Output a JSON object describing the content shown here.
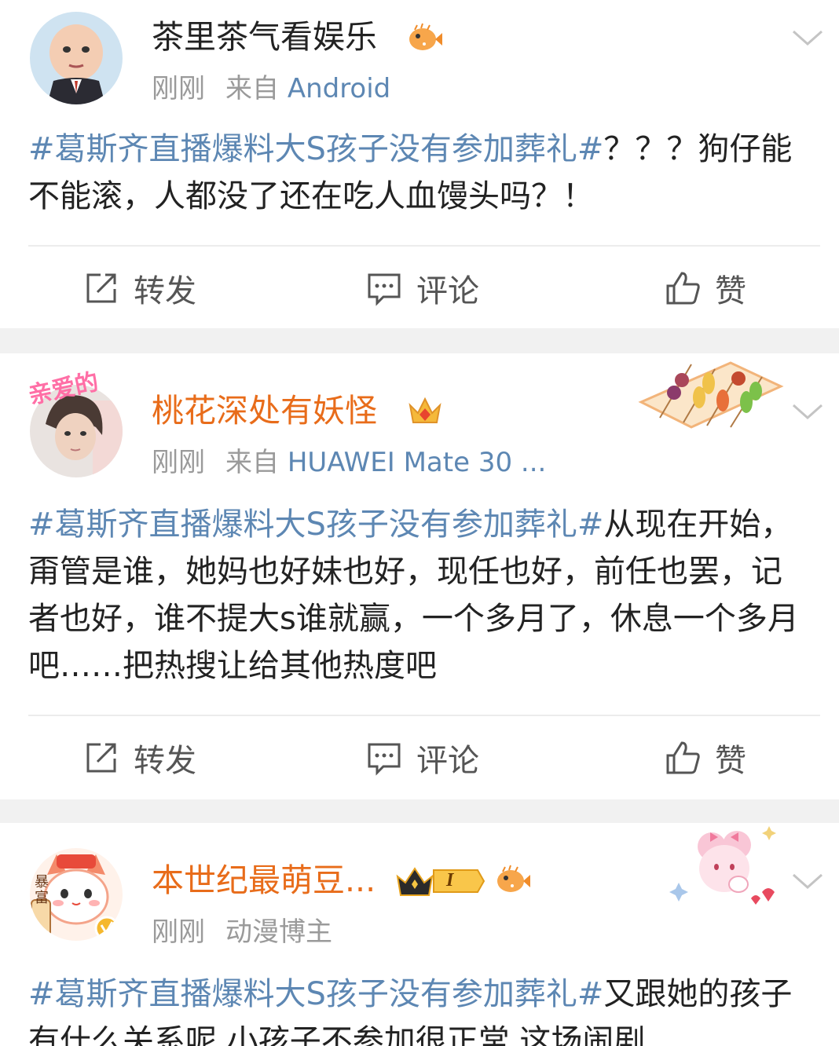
{
  "posts": [
    {
      "user": {
        "name": "茶里茶气看娱乐",
        "badge_icon": "pufferfish-badge-icon"
      },
      "meta": {
        "time": "刚刚",
        "source_prefix": "来自",
        "source": "Android"
      },
      "content": {
        "hashtag": "#葛斯齐直播爆料大S孩子没有参加葬礼#",
        "text": "？？？狗仔能不能滚，人都没了还在吃人血馒头吗？！"
      },
      "actions": {
        "repost": "转发",
        "comment": "评论",
        "like": "赞"
      }
    },
    {
      "user": {
        "name": "桃花深处有妖怪",
        "badge_icon": "crown-badge-icon",
        "avatar_sticker": "亲爱的"
      },
      "meta": {
        "time": "刚刚",
        "source_prefix": "来自",
        "source": "HUAWEI Mate 30 ..."
      },
      "content": {
        "hashtag": "#葛斯齐直播爆料大S孩子没有参加葬礼#",
        "text": "从现在开始，甭管是谁，她妈也好妹也好，现任也好，前任也罢，记者也好，谁不提大s谁就赢，一个多月了，休息一个多月吧……把热搜让给其他热度吧"
      },
      "actions": {
        "repost": "转发",
        "comment": "评论",
        "like": "赞"
      }
    },
    {
      "user": {
        "name": "本世纪最萌豆...",
        "badge_icon": "crown-level-badge-icon",
        "level": "I",
        "avatar_tag": "暴富"
      },
      "meta": {
        "time": "刚刚",
        "tag": "动漫博主"
      },
      "content": {
        "hashtag": "#葛斯齐直播爆料大S孩子没有参加葬礼#",
        "text": "又跟她的孩子有什么关系呢 小孩子不参加很正常 这场闹剧"
      }
    }
  ],
  "colors": {
    "link": "#5d87b3",
    "vip_name": "#e86c1a",
    "meta": "#9a9a9a",
    "separator": "#f1f1f1"
  }
}
